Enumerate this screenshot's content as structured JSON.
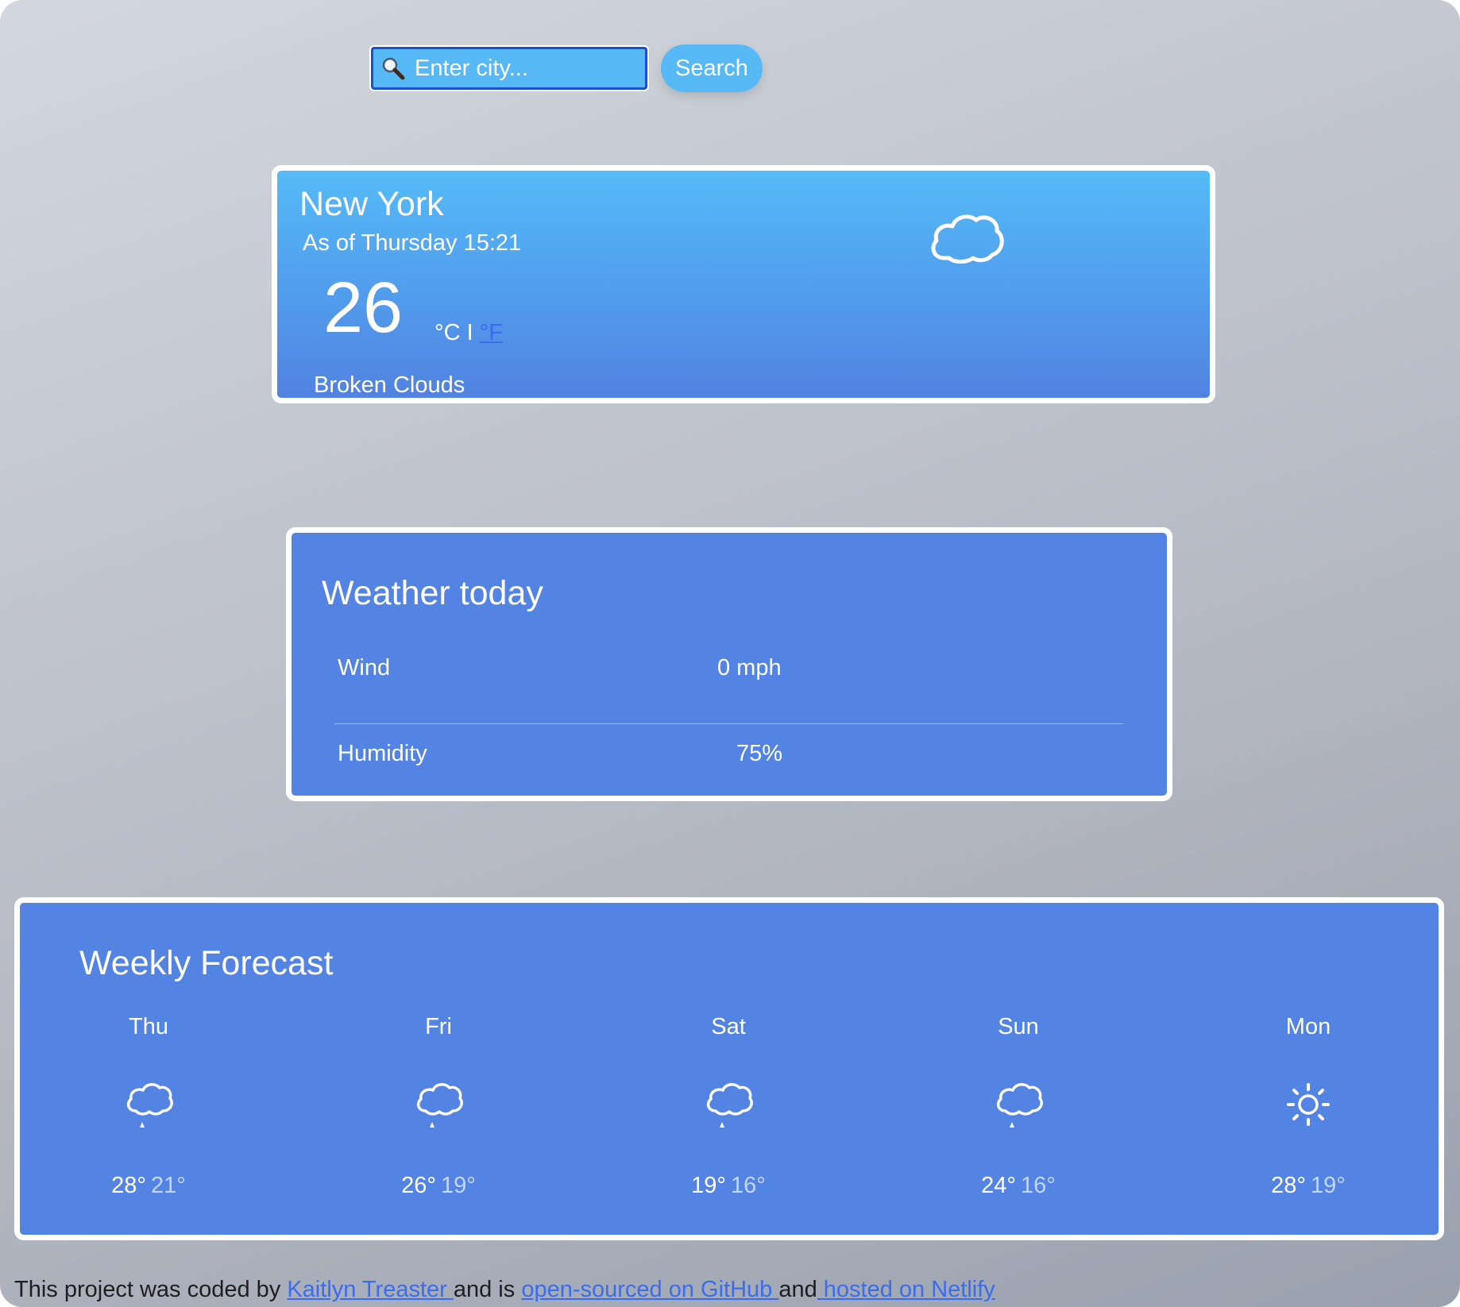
{
  "search": {
    "placeholder": "Enter city...",
    "button_label": "Search"
  },
  "current": {
    "city": "New York",
    "as_of": "As of Thursday 15:21",
    "temperature": "26",
    "unit_c": "°C",
    "unit_separator": " I ",
    "unit_f": "°F",
    "description": "Broken Clouds",
    "icon": "cloud-icon"
  },
  "today": {
    "title": "Weather today",
    "rows": [
      {
        "label": "Wind",
        "value": "0 mph"
      },
      {
        "label": "Humidity",
        "value": "75%"
      }
    ]
  },
  "weekly": {
    "title": "Weekly Forecast",
    "days": [
      {
        "day": "Thu",
        "icon": "rain-cloud-icon",
        "max": "28°",
        "min": "21°"
      },
      {
        "day": "Fri",
        "icon": "rain-cloud-icon",
        "max": "26°",
        "min": "19°"
      },
      {
        "day": "Sat",
        "icon": "rain-cloud-icon",
        "max": "19°",
        "min": "16°"
      },
      {
        "day": "Sun",
        "icon": "rain-cloud-icon",
        "max": "24°",
        "min": "16°"
      },
      {
        "day": "Mon",
        "icon": "sun-icon",
        "max": "28°",
        "min": "19°"
      }
    ]
  },
  "footer": {
    "prefix": "This project was coded by ",
    "author_link": "Kaitlyn Treaster ",
    "middle": "and is ",
    "github_link": "open-sourced on GitHub ",
    "and": "and",
    "netlify_link": " hosted on Netlify"
  },
  "colors": {
    "accent": "#56b9f5",
    "card": "#5383e3",
    "link": "#3a6cf0"
  }
}
